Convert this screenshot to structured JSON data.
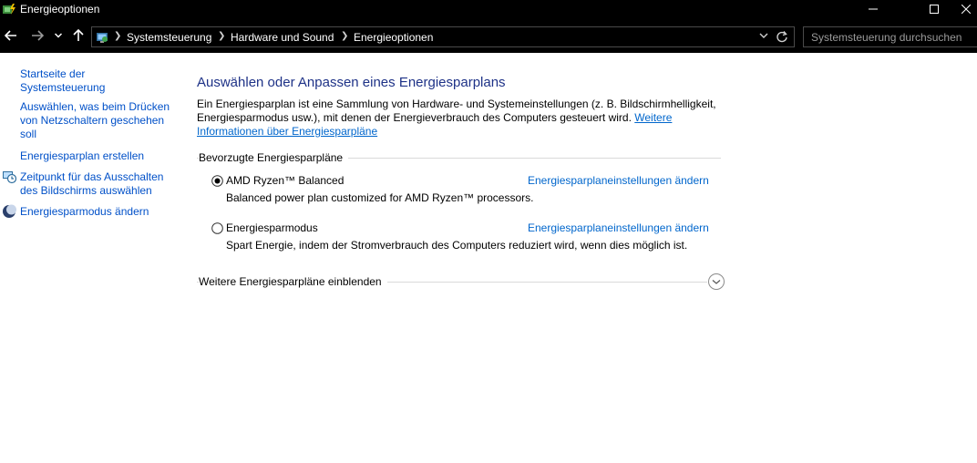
{
  "window": {
    "title": "Energieoptionen"
  },
  "breadcrumb": {
    "items": [
      "Systemsteuerung",
      "Hardware und Sound",
      "Energieoptionen"
    ]
  },
  "search": {
    "placeholder": "Systemsteuerung durchsuchen"
  },
  "sidebar": {
    "items": [
      {
        "label": "Startseite der Systemsteuerung",
        "icon": ""
      },
      {
        "label": "Auswählen, was beim Drücken von Netzschaltern geschehen soll",
        "icon": ""
      },
      {
        "label": "Energiesparplan erstellen",
        "icon": ""
      },
      {
        "label": "Zeitpunkt für das Ausschalten des Bildschirms auswählen",
        "icon": "clock-monitor-icon"
      },
      {
        "label": "Energiesparmodus ändern",
        "icon": "moon-icon"
      }
    ]
  },
  "main": {
    "heading": "Auswählen oder Anpassen eines Energiesparplans",
    "intro": "Ein Energiesparplan ist eine Sammlung von Hardware- und Systemeinstellungen (z. B. Bildschirmhelligkeit, Energiesparmodus usw.), mit denen der Energieverbrauch des Computers gesteuert wird.",
    "intro_link": "Weitere Informationen über Energiesparpläne",
    "group_label": "Bevorzugte Energiesparpläne",
    "plans": [
      {
        "name": "AMD Ryzen™ Balanced",
        "description": "Balanced power plan customized for AMD Ryzen™ processors.",
        "link": "Energiesparplaneinstellungen ändern",
        "selected": true
      },
      {
        "name": "Energiesparmodus",
        "description": "Spart Energie, indem der Stromverbrauch des Computers reduziert wird, wenn dies möglich ist.",
        "link": "Energiesparplaneinstellungen ändern",
        "selected": false
      }
    ],
    "more_plans_label": "Weitere Energiesparpläne einblenden"
  },
  "colors": {
    "link": "#0066cc",
    "heading": "#1e3287",
    "chrome": "#000000"
  }
}
